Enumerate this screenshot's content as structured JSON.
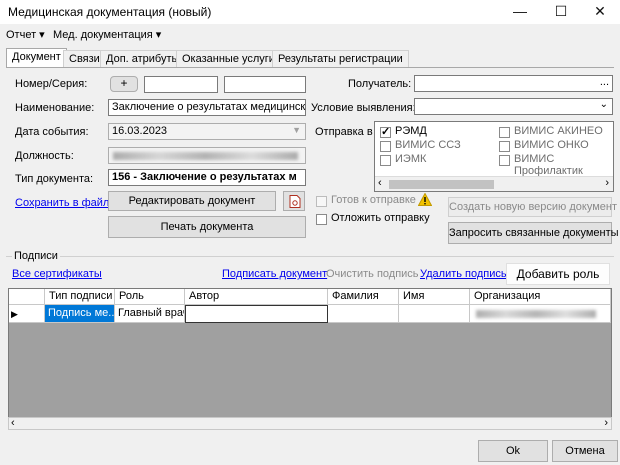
{
  "window": {
    "title": "Медицинская документация (новый)",
    "minimize": "—",
    "maximize": "☐",
    "close": "✕"
  },
  "menu": {
    "report": "Отчет ▾",
    "med_docs": "Мед. документация ▾"
  },
  "tabs": [
    "Документ",
    "Связи",
    "Доп. атрибуты",
    "Оказанные услуги",
    "Результаты регистрации"
  ],
  "form": {
    "number_label": "Номер/Серия:",
    "plus": "+",
    "name_label": "Наименование:",
    "name_value": "Заключение о результатах медицинского с",
    "event_date_label": "Дата события:",
    "event_date_value": "16.03.2023",
    "position_label": "Должность:",
    "doc_type_label": "Тип документа:",
    "doc_type_value": "156 - Заключение о результатах м",
    "save_file_link": "Сохранить в файл",
    "edit_doc_button": "Редактировать документ",
    "print_doc_button": "Печать документа",
    "recipient_label": "Получатель:",
    "ellipsis": "...",
    "condition_label": "Условие выявления:",
    "send_to_label": "Отправка в",
    "send_targets": [
      {
        "label": "РЭМД",
        "checked": true
      },
      {
        "label": "ВИМИС АКИНЕО",
        "checked": false
      },
      {
        "label": "ВИМИС ССЗ",
        "checked": false
      },
      {
        "label": "ВИМИС ОНКО",
        "checked": false
      },
      {
        "label": "ИЭМК",
        "checked": false
      },
      {
        "label": "ВИМИС Профилактик",
        "checked": false
      }
    ],
    "ready_label": "Готов к отправке",
    "postpone_label": "Отложить отправку",
    "new_version_button": "Создать новую версию документ",
    "request_related_button": "Запросить связанные документы"
  },
  "signatures": {
    "group_label": "Подписи",
    "all_certs_link": "Все сертификаты",
    "sign_doc_link": "Подписать документ",
    "clear_signs_link": "Очистить подпись",
    "delete_sign_link": "Удалить подпись",
    "add_role_button": "Добавить роль",
    "columns": [
      "Тип подписи",
      "Роль",
      "Автор",
      "Фамилия",
      "Имя",
      "Организация"
    ],
    "rows": [
      {
        "type": "Подпись ме...",
        "role": "Главный врач",
        "author": "",
        "surname": "",
        "name": "",
        "org": ""
      }
    ]
  },
  "footer": {
    "ok": "Ok",
    "cancel": "Отмена"
  },
  "colors": {
    "selection": "#0078d7",
    "link": "#0000ee",
    "grid_bg": "#a0a0a0",
    "warning": "#f2c200"
  }
}
